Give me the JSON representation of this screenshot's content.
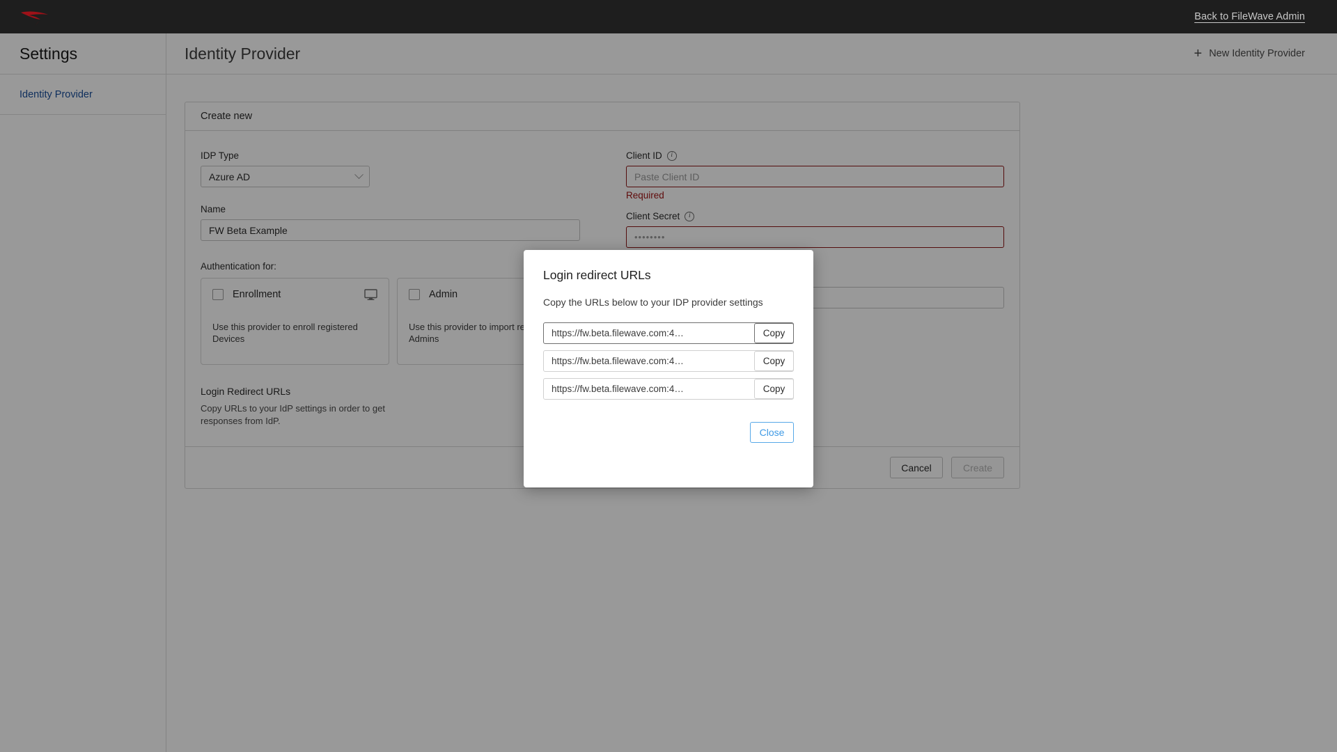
{
  "topbar": {
    "logo_icon": "filewave-logo-icon",
    "back_link": "Back to FileWave Admin"
  },
  "sidebar": {
    "title": "Settings",
    "items": [
      {
        "label": "Identity Provider"
      }
    ]
  },
  "content": {
    "title": "Identity Provider",
    "new_button": {
      "icon": "plus-icon",
      "label": "New Identity Provider"
    }
  },
  "form": {
    "card_title": "Create new",
    "idp_type": {
      "label": "IDP Type",
      "value": "Azure AD",
      "chevron_icon": "chevron-down-icon"
    },
    "name": {
      "label": "Name",
      "value": "FW Beta Example"
    },
    "client_id": {
      "label": "Client ID",
      "info_icon": "info-icon",
      "placeholder": "Paste Client ID",
      "value": "",
      "error": "Required"
    },
    "client_secret": {
      "label": "Client Secret",
      "info_icon": "info-icon",
      "value": "••••••••"
    },
    "extra_field": {
      "value": ""
    },
    "auth_section_label": "Authentication for:",
    "auth_cards": [
      {
        "name": "Enrollment",
        "description": "Use this provider to enroll registered Devices",
        "icon": "monitor-icon",
        "checked": false
      },
      {
        "name": "Admin",
        "description": "Use this provider to import registered Admins",
        "icon": "",
        "checked": false
      }
    ],
    "login_redirect": {
      "title": "Login Redirect URLs",
      "description": "Copy URLs to your IdP settings in order to get responses from IdP.",
      "button_icon": "open-external-icon"
    },
    "footer": {
      "cancel_label": "Cancel",
      "create_label": "Create"
    }
  },
  "modal": {
    "title": "Login redirect URLs",
    "subtitle": "Copy the URLs below to your IDP provider settings",
    "urls": [
      {
        "url": "https://fw.beta.filewave.com:4…",
        "copy_label": "Copy"
      },
      {
        "url": "https://fw.beta.filewave.com:4…",
        "copy_label": "Copy"
      },
      {
        "url": "https://fw.beta.filewave.com:4…",
        "copy_label": "Copy"
      }
    ],
    "close_label": "Close"
  },
  "colors": {
    "brand_red": "#9e1118",
    "topbar_bg": "#1e1e1e",
    "link_blue": "#1a4f9c",
    "accent_blue": "#3f9ae5",
    "error_red": "#9e1111",
    "field_error_border": "#8c1515"
  }
}
